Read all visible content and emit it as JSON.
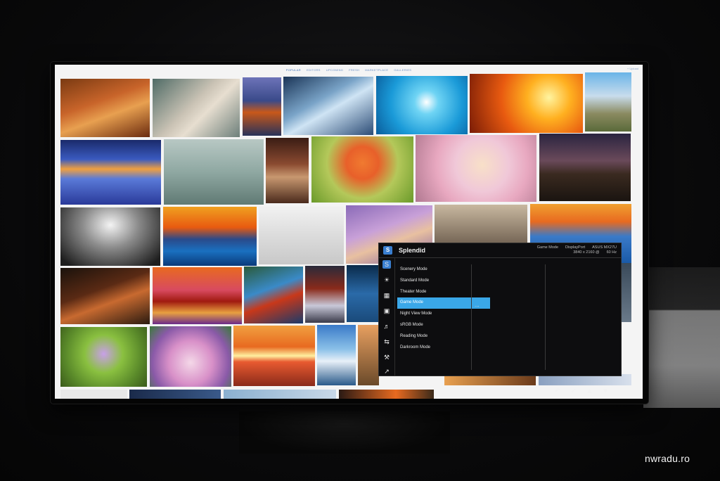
{
  "site_nav": {
    "items": [
      "POPULAR",
      "EDITORS",
      "UPCOMING",
      "FRESH",
      "MARKETPLACE",
      "GALLERIES"
    ],
    "top_right": "+ Upload"
  },
  "osd": {
    "title": "Splendid",
    "logo_text": "S",
    "status": {
      "current_mode": "Game Mode",
      "input": "DisplayPort",
      "model": "ASUS MX27U",
      "resolution": "3840 x 2160 @",
      "refresh": "60 Hz"
    },
    "modes": [
      "Scenery Mode",
      "Standard Mode",
      "Theater Mode",
      "Game Mode",
      "Night View Mode",
      "sRGB Mode",
      "Reading Mode",
      "Darkroom Mode"
    ],
    "selected_index": 3,
    "more_indicator": "...",
    "side_icons": [
      "splendid-icon",
      "brightness-icon",
      "color-icon",
      "image-icon",
      "sound-icon",
      "input-select-icon",
      "system-setup-icon",
      "shortcut-icon"
    ]
  },
  "osd_keys": [
    "back-icon",
    "confirm-icon",
    "up-icon",
    "down-icon"
  ],
  "watermark": "nwradu.ro"
}
